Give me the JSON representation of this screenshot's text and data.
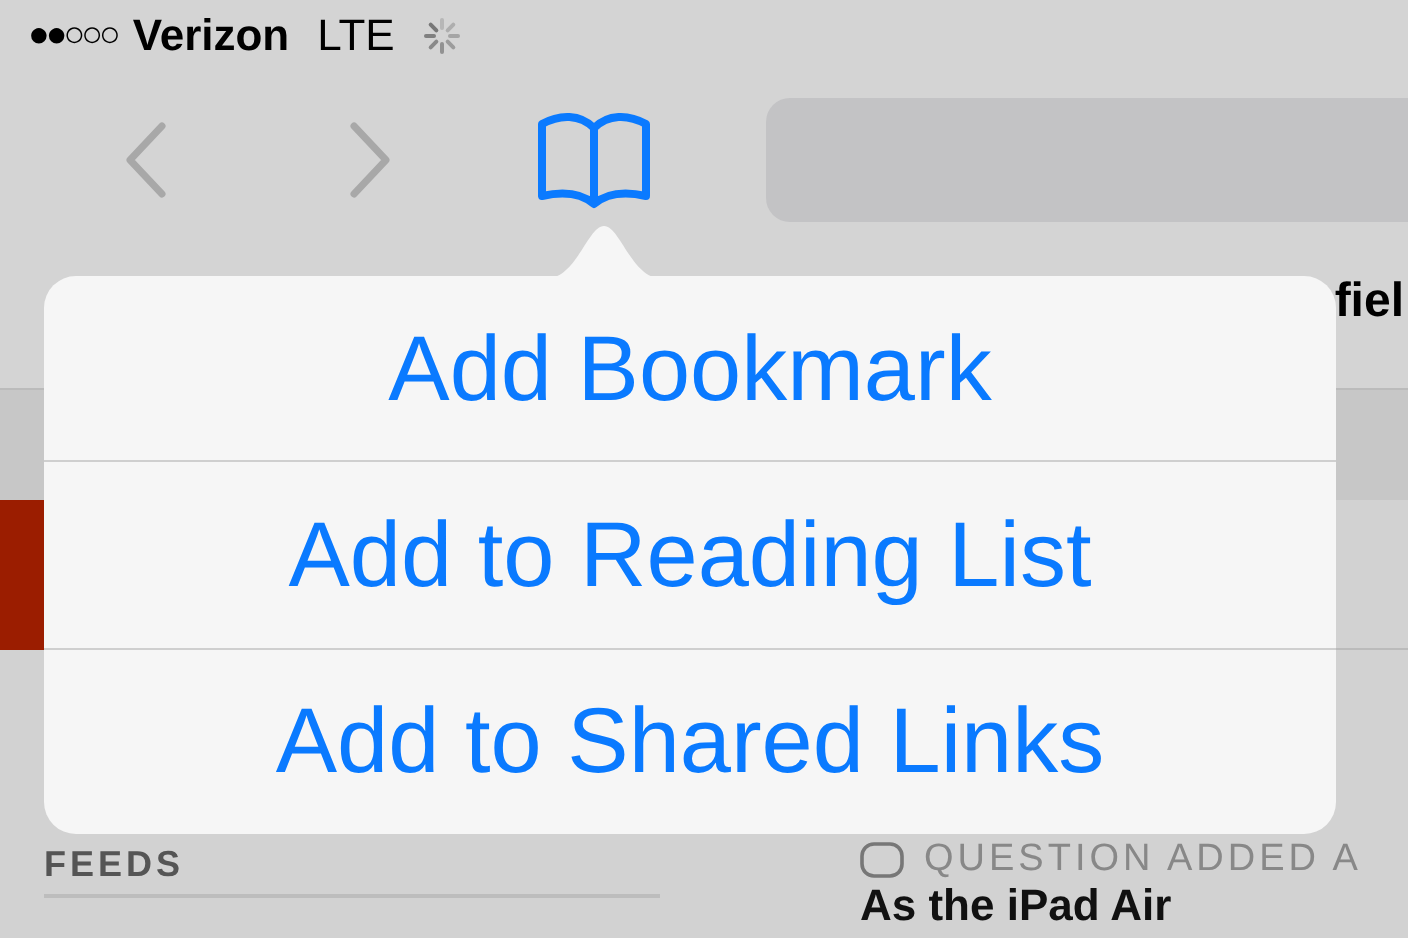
{
  "status_bar": {
    "signal": "●●○○○",
    "carrier": "Verizon",
    "network": "LTE"
  },
  "bookmarks_bar": {
    "visible_text": "fiel"
  },
  "popover": {
    "items": [
      {
        "label": "Add Bookmark"
      },
      {
        "label": "Add to Reading List"
      },
      {
        "label": "Add to Shared Links"
      }
    ]
  },
  "page": {
    "section_title": "FEEDS",
    "tag": "QUESTION ADDED A",
    "headline": "As the iPad Air"
  }
}
